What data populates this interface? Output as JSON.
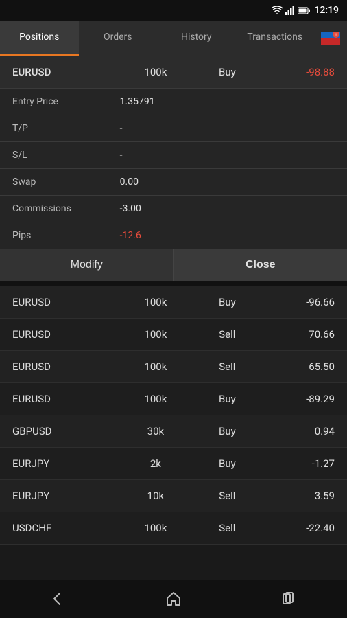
{
  "statusBar": {
    "time": "12:19"
  },
  "tabs": [
    {
      "id": "positions",
      "label": "Positions",
      "active": true
    },
    {
      "id": "orders",
      "label": "Orders",
      "active": false
    },
    {
      "id": "history",
      "label": "History",
      "active": false
    },
    {
      "id": "transactions",
      "label": "Transactions",
      "active": false
    }
  ],
  "expandedPosition": {
    "symbol": "EURUSD",
    "amount": "100k",
    "type": "Buy",
    "pnl": "-98.88",
    "pnlClass": "negative",
    "details": [
      {
        "label": "Entry Price",
        "value": "1.35791",
        "valueClass": ""
      },
      {
        "label": "T/P",
        "value": "-",
        "valueClass": ""
      },
      {
        "label": "S/L",
        "value": "-",
        "valueClass": ""
      },
      {
        "label": "Swap",
        "value": "0.00",
        "valueClass": ""
      },
      {
        "label": "Commissions",
        "value": "-3.00",
        "valueClass": ""
      },
      {
        "label": "Pips",
        "value": "-12.6",
        "valueClass": "negative"
      }
    ],
    "actions": {
      "modify": "Modify",
      "close": "Close"
    }
  },
  "positions": [
    {
      "symbol": "EURUSD",
      "amount": "100k",
      "type": "Buy",
      "pnl": "-96.66",
      "pnlClass": "negative"
    },
    {
      "symbol": "EURUSD",
      "amount": "100k",
      "type": "Sell",
      "pnl": "70.66",
      "pnlClass": "positive"
    },
    {
      "symbol": "EURUSD",
      "amount": "100k",
      "type": "Sell",
      "pnl": "65.50",
      "pnlClass": "positive"
    },
    {
      "symbol": "EURUSD",
      "amount": "100k",
      "type": "Buy",
      "pnl": "-89.29",
      "pnlClass": "negative"
    },
    {
      "symbol": "GBPUSD",
      "amount": "30k",
      "type": "Buy",
      "pnl": "0.94",
      "pnlClass": "positive"
    },
    {
      "symbol": "EURJPY",
      "amount": "2k",
      "type": "Buy",
      "pnl": "-1.27",
      "pnlClass": "negative"
    },
    {
      "symbol": "EURJPY",
      "amount": "10k",
      "type": "Sell",
      "pnl": "3.59",
      "pnlClass": "positive"
    },
    {
      "symbol": "USDCHF",
      "amount": "100k",
      "type": "Sell",
      "pnl": "-22.40",
      "pnlClass": "negative"
    }
  ],
  "bottomNav": {
    "back": "back",
    "home": "home",
    "recent": "recent"
  }
}
